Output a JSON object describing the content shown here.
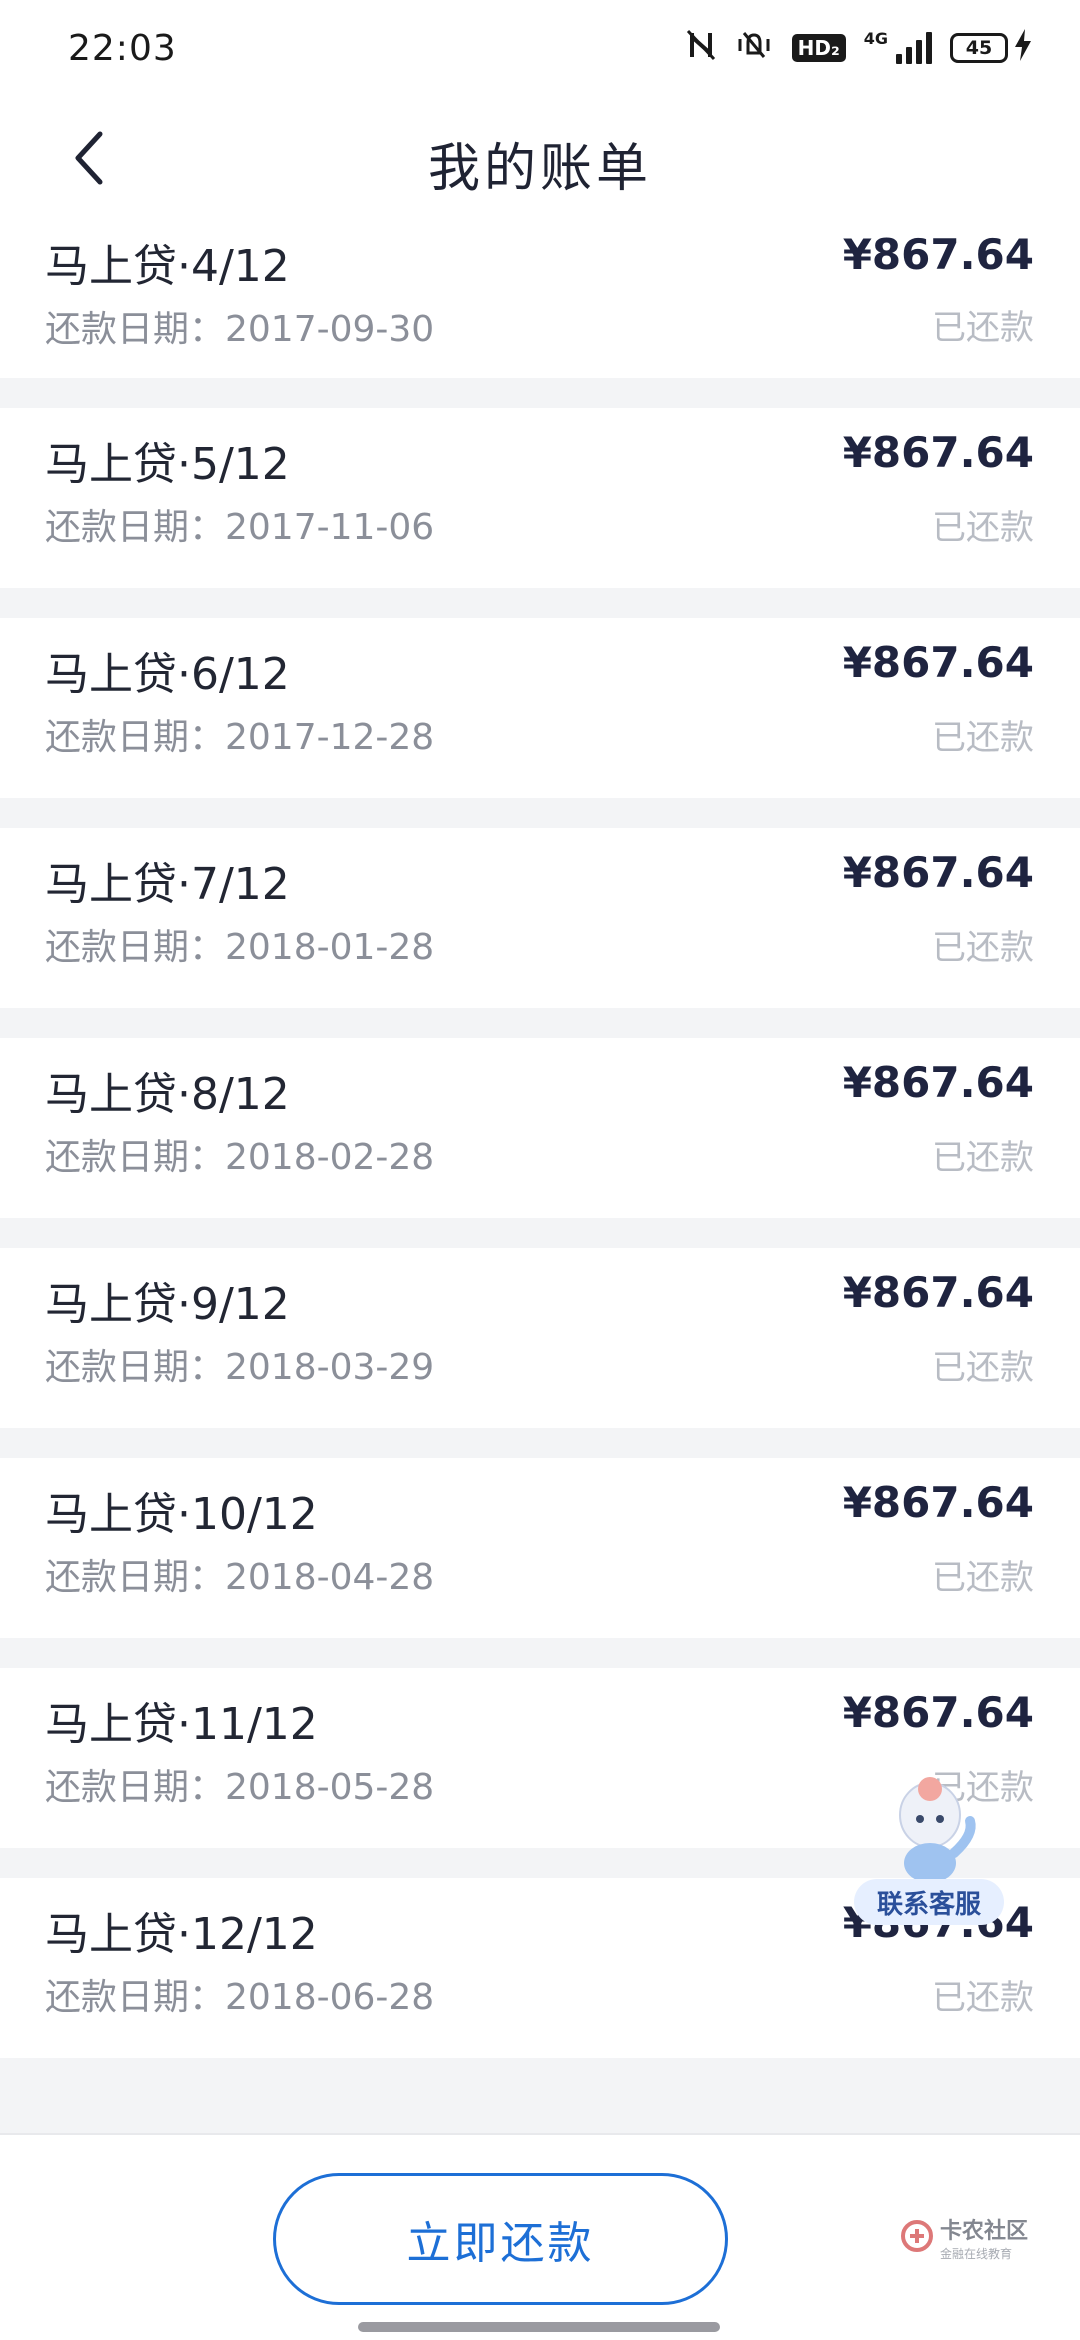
{
  "status_bar": {
    "time": "22:03",
    "hd_label": "HD₂",
    "network_type": "4G",
    "battery": "45"
  },
  "header": {
    "title": "我的账单"
  },
  "bills": [
    {
      "title": "马上贷·4/12",
      "date": "还款日期：2017-09-30",
      "amount": "¥867.64",
      "status": "已还款"
    },
    {
      "title": "马上贷·5/12",
      "date": "还款日期：2017-11-06",
      "amount": "¥867.64",
      "status": "已还款"
    },
    {
      "title": "马上贷·6/12",
      "date": "还款日期：2017-12-28",
      "amount": "¥867.64",
      "status": "已还款"
    },
    {
      "title": "马上贷·7/12",
      "date": "还款日期：2018-01-28",
      "amount": "¥867.64",
      "status": "已还款"
    },
    {
      "title": "马上贷·8/12",
      "date": "还款日期：2018-02-28",
      "amount": "¥867.64",
      "status": "已还款"
    },
    {
      "title": "马上贷·9/12",
      "date": "还款日期：2018-03-29",
      "amount": "¥867.64",
      "status": "已还款"
    },
    {
      "title": "马上贷·10/12",
      "date": "还款日期：2018-04-28",
      "amount": "¥867.64",
      "status": "已还款"
    },
    {
      "title": "马上贷·11/12",
      "date": "还款日期：2018-05-28",
      "amount": "¥867.64",
      "status": "已还款"
    },
    {
      "title": "马上贷·12/12",
      "date": "还款日期：2018-06-28",
      "amount": "¥867.64",
      "status": "已还款"
    }
  ],
  "service": {
    "label": "联系客服"
  },
  "footer": {
    "pay_button": "立即还款",
    "watermark_main": "卡农社区",
    "watermark_sub": "金融在线教育"
  },
  "colors": {
    "accent": "#1d6fd6",
    "background": "#f3f4f6",
    "amount": "#1f2440",
    "muted": "#b8bcc4"
  },
  "icons": [
    "back-icon",
    "nfc-off-icon",
    "vibrate-icon",
    "signal-icon",
    "battery-icon",
    "charging-icon",
    "customer-service-mascot-icon"
  ]
}
